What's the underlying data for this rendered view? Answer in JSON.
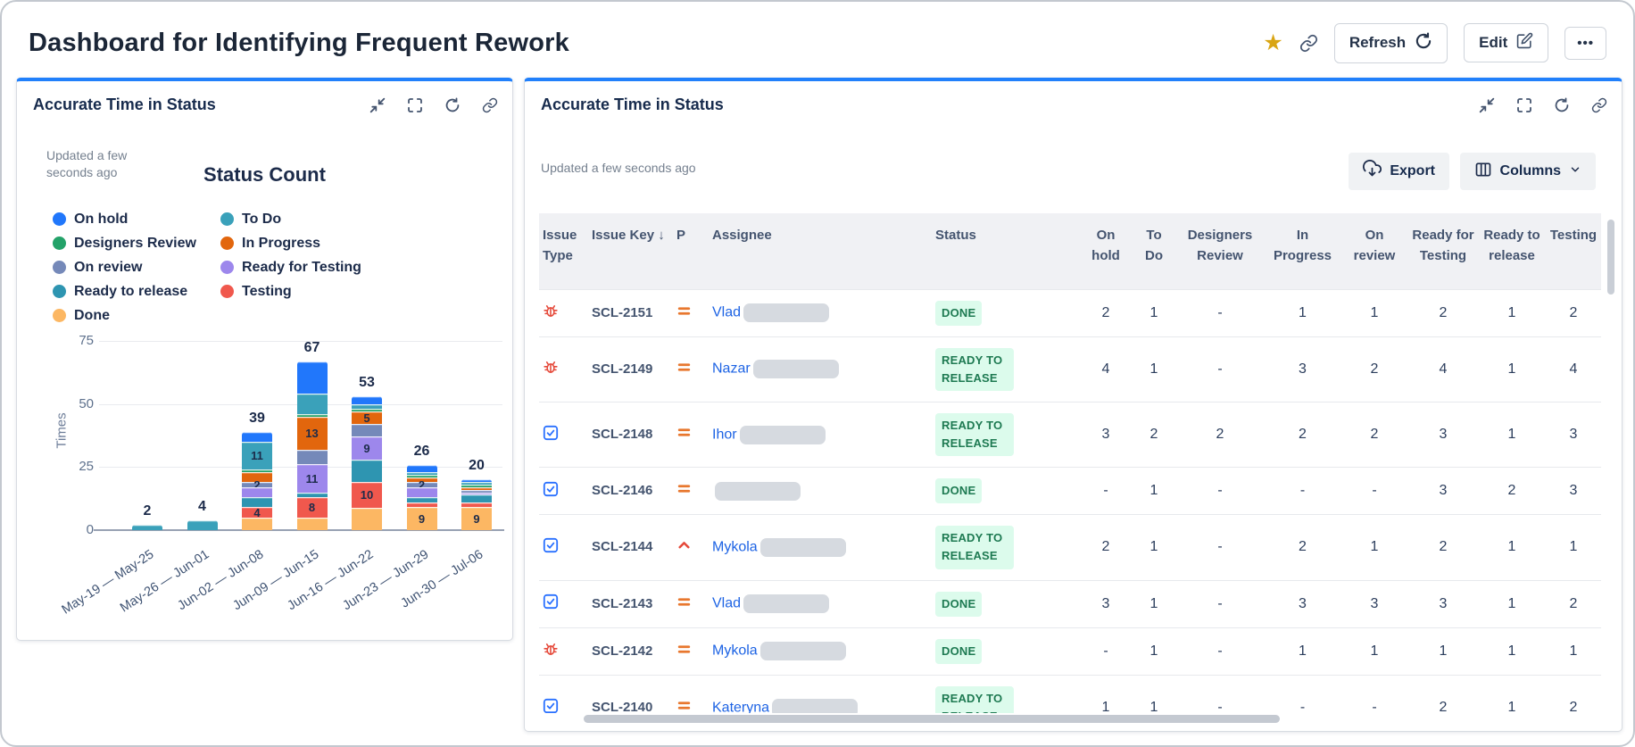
{
  "page": {
    "title": "Dashboard for Identifying Frequent Rework"
  },
  "topbar": {
    "star_glyph": "★",
    "refresh_label": "Refresh",
    "edit_label": "Edit",
    "more_label": "•••"
  },
  "left_panel": {
    "title": "Accurate Time in Status",
    "updated": "Updated a few seconds ago"
  },
  "right_panel": {
    "title": "Accurate Time in Status",
    "updated": "Updated a few seconds ago",
    "export_label": "Export",
    "columns_label": "Columns"
  },
  "chart_data": {
    "type": "bar",
    "stacked": true,
    "title": "Status Count",
    "xlabel": "",
    "ylabel": "Times",
    "ylim": [
      0,
      75
    ],
    "yticks": [
      0,
      25,
      50,
      75
    ],
    "grid": true,
    "legend_position": "top-left-two-columns",
    "legend_order": [
      "On hold",
      "Designers Review",
      "On review",
      "Ready to release",
      "Done",
      "To Do",
      "In Progress",
      "Ready for Testing",
      "Testing"
    ],
    "categories": [
      "May-19 — May-25",
      "May-26 — Jun-01",
      "Jun-02 — Jun-08",
      "Jun-09 — Jun-15",
      "Jun-16 — Jun-22",
      "Jun-23 — Jun-29",
      "Jun-30 — Jul-06"
    ],
    "totals": [
      2,
      4,
      39,
      67,
      53,
      26,
      20
    ],
    "series": [
      {
        "name": "Done",
        "color": "#FCB763",
        "values": [
          0,
          0,
          5,
          5,
          9,
          9,
          9
        ],
        "labels": [
          null,
          null,
          null,
          null,
          null,
          9,
          9
        ]
      },
      {
        "name": "Testing",
        "color": "#F0584D",
        "values": [
          0,
          0,
          4,
          8,
          10,
          2,
          2
        ],
        "labels": [
          null,
          null,
          4,
          8,
          10,
          null,
          null
        ]
      },
      {
        "name": "Ready to release",
        "color": "#2E95B1",
        "values": [
          0,
          0,
          4,
          2,
          9,
          2,
          3
        ],
        "labels": [
          null,
          null,
          null,
          null,
          null,
          null,
          null
        ]
      },
      {
        "name": "Ready for Testing",
        "color": "#9D87EC",
        "values": [
          0,
          0,
          4,
          11,
          9,
          4,
          1
        ],
        "labels": [
          null,
          null,
          null,
          11,
          9,
          null,
          null
        ]
      },
      {
        "name": "On review",
        "color": "#7589B9",
        "values": [
          0,
          0,
          2,
          6,
          5,
          2,
          1
        ],
        "labels": [
          null,
          null,
          2,
          null,
          null,
          2,
          null
        ]
      },
      {
        "name": "In Progress",
        "color": "#E2660D",
        "values": [
          0,
          0,
          4,
          13,
          5,
          2,
          1
        ],
        "labels": [
          null,
          null,
          null,
          13,
          5,
          null,
          null
        ]
      },
      {
        "name": "Designers Review",
        "color": "#23A269",
        "values": [
          0,
          0,
          1,
          1,
          1,
          1,
          1
        ],
        "labels": [
          null,
          null,
          null,
          null,
          null,
          null,
          null
        ]
      },
      {
        "name": "To Do",
        "color": "#3AA1BA",
        "values": [
          2,
          4,
          11,
          8,
          2,
          1,
          1
        ],
        "labels": [
          null,
          null,
          11,
          null,
          null,
          null,
          null
        ]
      },
      {
        "name": "On hold",
        "color": "#2177FB",
        "values": [
          0,
          0,
          4,
          13,
          3,
          3,
          1
        ],
        "labels": [
          null,
          null,
          null,
          null,
          null,
          null,
          null
        ]
      }
    ]
  },
  "table": {
    "sort_desc_glyph": "↓",
    "columns": [
      {
        "label": "Issue Type",
        "align": "left"
      },
      {
        "label": "Issue Key",
        "align": "left",
        "sorted": "desc"
      },
      {
        "label": "P",
        "align": "left"
      },
      {
        "label": "Assignee",
        "align": "left"
      },
      {
        "label": "Status",
        "align": "left"
      },
      {
        "label": "On hold",
        "align": "center"
      },
      {
        "label": "To Do",
        "align": "center"
      },
      {
        "label": "Designers Review",
        "align": "center"
      },
      {
        "label": "In Progress",
        "align": "center"
      },
      {
        "label": "On review",
        "align": "center"
      },
      {
        "label": "Ready for Testing",
        "align": "center"
      },
      {
        "label": "Ready to release",
        "align": "center"
      },
      {
        "label": "Testing",
        "align": "center"
      }
    ],
    "rows": [
      {
        "type": "bug",
        "key": "SCL-2151",
        "priority": "medium",
        "assignee": "Vlad",
        "redacted": true,
        "status": "DONE",
        "values": [
          "2",
          "1",
          "-",
          "1",
          "1",
          "2",
          "1",
          "2"
        ]
      },
      {
        "type": "bug",
        "key": "SCL-2149",
        "priority": "medium",
        "assignee": "Nazar",
        "redacted": true,
        "status": "READY TO RELEASE",
        "values": [
          "4",
          "1",
          "-",
          "3",
          "2",
          "4",
          "1",
          "4"
        ]
      },
      {
        "type": "task",
        "key": "SCL-2148",
        "priority": "medium",
        "assignee": "Ihor",
        "redacted": true,
        "status": "READY TO RELEASE",
        "values": [
          "3",
          "2",
          "2",
          "2",
          "2",
          "3",
          "1",
          "3"
        ]
      },
      {
        "type": "task",
        "key": "SCL-2146",
        "priority": "medium",
        "assignee": "",
        "redacted": true,
        "status": "DONE",
        "values": [
          "-",
          "1",
          "-",
          "-",
          "-",
          "3",
          "2",
          "3"
        ]
      },
      {
        "type": "task",
        "key": "SCL-2144",
        "priority": "high",
        "assignee": "Mykola",
        "redacted": true,
        "status": "READY TO RELEASE",
        "values": [
          "2",
          "1",
          "-",
          "2",
          "1",
          "2",
          "1",
          "1"
        ]
      },
      {
        "type": "task",
        "key": "SCL-2143",
        "priority": "medium",
        "assignee": "Vlad",
        "redacted": true,
        "status": "DONE",
        "values": [
          "3",
          "1",
          "-",
          "3",
          "3",
          "3",
          "1",
          "2"
        ]
      },
      {
        "type": "bug",
        "key": "SCL-2142",
        "priority": "medium",
        "assignee": "Mykola",
        "redacted": true,
        "status": "DONE",
        "values": [
          "-",
          "1",
          "-",
          "1",
          "1",
          "1",
          "1",
          "1"
        ]
      },
      {
        "type": "task",
        "key": "SCL-2140",
        "priority": "medium",
        "assignee": "Kateryna",
        "redacted": true,
        "status": "READY TO RELEASE",
        "values": [
          "1",
          "1",
          "-",
          "-",
          "-",
          "2",
          "1",
          "2"
        ]
      }
    ],
    "status_colors": {
      "text": "#1E7A52",
      "bg": "#DCFBEC"
    }
  }
}
